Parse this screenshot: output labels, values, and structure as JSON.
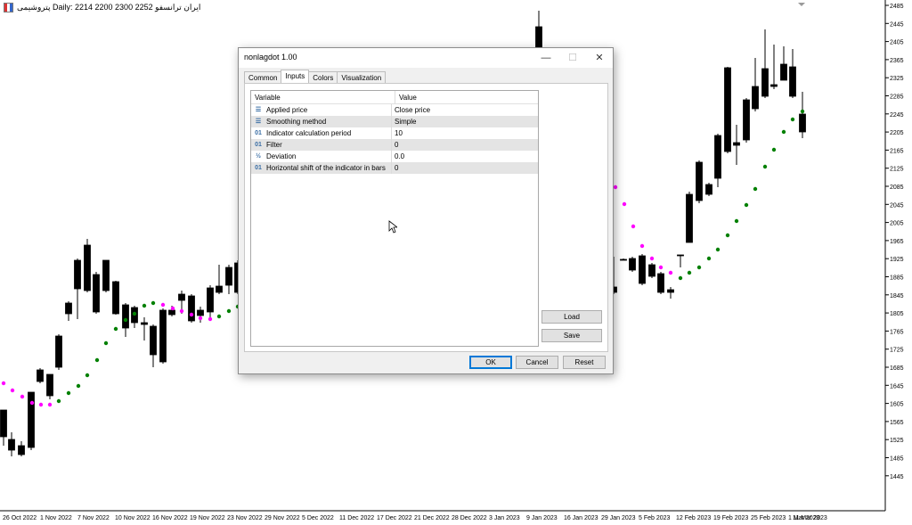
{
  "chart": {
    "title": "پتروشیمی Daily:  2214 2200 2300 2252  ایران ترانسفو",
    "price_labels": [
      "2485",
      "2445",
      "2405",
      "2365",
      "2325",
      "2285",
      "2245",
      "2205",
      "2165",
      "2125",
      "2085",
      "2045",
      "2005",
      "1965",
      "1925",
      "1885",
      "1845",
      "1805",
      "1765",
      "1725",
      "1685",
      "1645",
      "1605",
      "1565",
      "1525",
      "1485",
      "1445"
    ],
    "date_labels": [
      "26 Oct 2022",
      "1 Nov 2022",
      "7 Nov 2022",
      "10 Nov 2022",
      "16 Nov 2022",
      "19 Nov 2022",
      "23 Nov 2022",
      "29 Nov 2022",
      "5 Dec 2022",
      "11 Dec 2022",
      "17 Dec 2022",
      "21 Dec 2022",
      "28 Dec 2022",
      "3 Jan 2023",
      "9 Jan 2023",
      "16 Jan 2023",
      "29 Jan 2023",
      "5 Feb 2023",
      "12 Feb 2023",
      "19 Feb 2023",
      "25 Feb 2023",
      "1 Mar 2023",
      "11 Mar 2023"
    ],
    "colors": {
      "bull_dot": "#008000",
      "bear_dot": "#ff00ff",
      "candle": "#000000"
    }
  },
  "dialog": {
    "title": "nonlagdot 1.00",
    "tabs": [
      "Common",
      "Inputs",
      "Colors",
      "Visualization"
    ],
    "active_tab": "Inputs",
    "headers": {
      "variable": "Variable",
      "value": "Value"
    },
    "rows": [
      {
        "icon": "☰",
        "variable": "Applied price",
        "value": "Close price"
      },
      {
        "icon": "☰",
        "variable": "Smoothing method",
        "value": "Simple"
      },
      {
        "icon": "01",
        "variable": "Indicator calculation period",
        "value": "10"
      },
      {
        "icon": "01",
        "variable": "Filter",
        "value": "0"
      },
      {
        "icon": "½",
        "variable": "Deviation",
        "value": "0.0"
      },
      {
        "icon": "01",
        "variable": "Horizontal shift of the indicator in bars",
        "value": "0"
      }
    ],
    "buttons": {
      "load": "Load",
      "save": "Save",
      "ok": "OK",
      "cancel": "Cancel",
      "reset": "Reset"
    }
  }
}
